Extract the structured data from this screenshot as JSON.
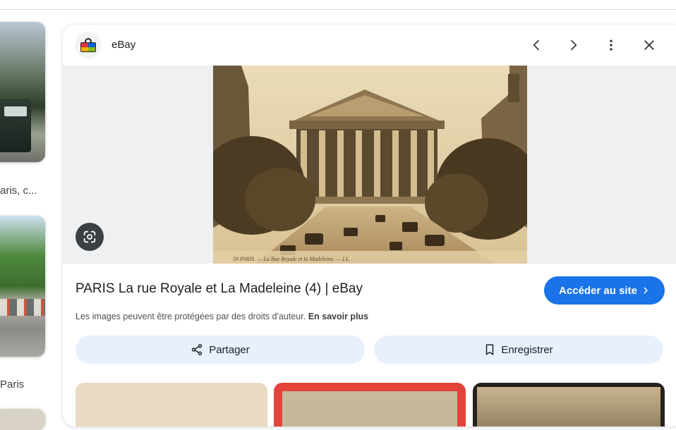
{
  "results": {
    "captions": [
      "aris, c...",
      "Paris"
    ]
  },
  "viewer": {
    "site_name": "eBay",
    "photo_caption": "59 PARIS. — La Rue Royale et la Madeleine. — LL.",
    "title": "PARIS La rue Royale et La Madeleine (4) | eBay",
    "visit_label": "Accéder au site",
    "copyright_text": "Les images peuvent être protégées par des droits d'auteur. ",
    "learn_more_label": "En savoir plus",
    "share_label": "Partager",
    "save_label": "Enregistrer"
  },
  "icons": [
    "ebay-favicon-icon",
    "chevron-left-icon",
    "chevron-right-icon",
    "more-vert-icon",
    "close-icon",
    "google-lens-icon",
    "chevron-right-small-icon",
    "share-icon",
    "bookmark-icon"
  ],
  "colors": {
    "accent": "#1a73e8",
    "tonal_button": "#e8f0fe",
    "text_primary": "#202124",
    "text_secondary": "#4d5156"
  }
}
